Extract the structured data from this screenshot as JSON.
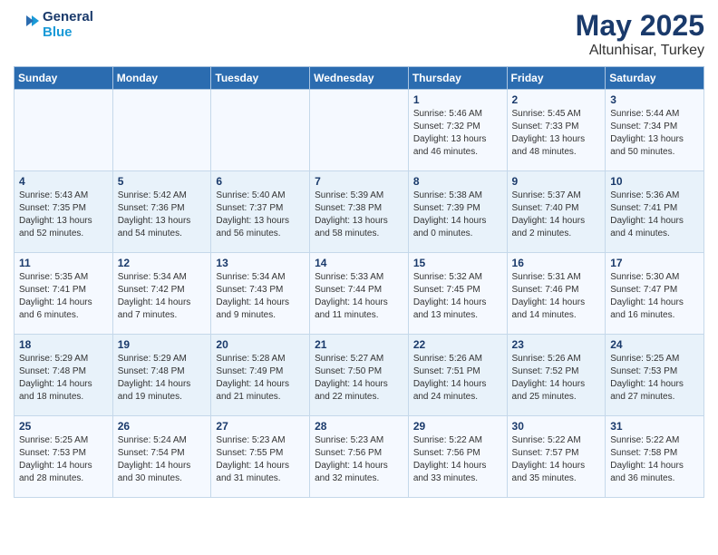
{
  "header": {
    "logo_line1": "General",
    "logo_line2": "Blue",
    "month": "May 2025",
    "location": "Altunhisar, Turkey"
  },
  "days_of_week": [
    "Sunday",
    "Monday",
    "Tuesday",
    "Wednesday",
    "Thursday",
    "Friday",
    "Saturday"
  ],
  "weeks": [
    [
      {
        "day": "",
        "info": ""
      },
      {
        "day": "",
        "info": ""
      },
      {
        "day": "",
        "info": ""
      },
      {
        "day": "",
        "info": ""
      },
      {
        "day": "1",
        "info": "Sunrise: 5:46 AM\nSunset: 7:32 PM\nDaylight: 13 hours\nand 46 minutes."
      },
      {
        "day": "2",
        "info": "Sunrise: 5:45 AM\nSunset: 7:33 PM\nDaylight: 13 hours\nand 48 minutes."
      },
      {
        "day": "3",
        "info": "Sunrise: 5:44 AM\nSunset: 7:34 PM\nDaylight: 13 hours\nand 50 minutes."
      }
    ],
    [
      {
        "day": "4",
        "info": "Sunrise: 5:43 AM\nSunset: 7:35 PM\nDaylight: 13 hours\nand 52 minutes."
      },
      {
        "day": "5",
        "info": "Sunrise: 5:42 AM\nSunset: 7:36 PM\nDaylight: 13 hours\nand 54 minutes."
      },
      {
        "day": "6",
        "info": "Sunrise: 5:40 AM\nSunset: 7:37 PM\nDaylight: 13 hours\nand 56 minutes."
      },
      {
        "day": "7",
        "info": "Sunrise: 5:39 AM\nSunset: 7:38 PM\nDaylight: 13 hours\nand 58 minutes."
      },
      {
        "day": "8",
        "info": "Sunrise: 5:38 AM\nSunset: 7:39 PM\nDaylight: 14 hours\nand 0 minutes."
      },
      {
        "day": "9",
        "info": "Sunrise: 5:37 AM\nSunset: 7:40 PM\nDaylight: 14 hours\nand 2 minutes."
      },
      {
        "day": "10",
        "info": "Sunrise: 5:36 AM\nSunset: 7:41 PM\nDaylight: 14 hours\nand 4 minutes."
      }
    ],
    [
      {
        "day": "11",
        "info": "Sunrise: 5:35 AM\nSunset: 7:41 PM\nDaylight: 14 hours\nand 6 minutes."
      },
      {
        "day": "12",
        "info": "Sunrise: 5:34 AM\nSunset: 7:42 PM\nDaylight: 14 hours\nand 7 minutes."
      },
      {
        "day": "13",
        "info": "Sunrise: 5:34 AM\nSunset: 7:43 PM\nDaylight: 14 hours\nand 9 minutes."
      },
      {
        "day": "14",
        "info": "Sunrise: 5:33 AM\nSunset: 7:44 PM\nDaylight: 14 hours\nand 11 minutes."
      },
      {
        "day": "15",
        "info": "Sunrise: 5:32 AM\nSunset: 7:45 PM\nDaylight: 14 hours\nand 13 minutes."
      },
      {
        "day": "16",
        "info": "Sunrise: 5:31 AM\nSunset: 7:46 PM\nDaylight: 14 hours\nand 14 minutes."
      },
      {
        "day": "17",
        "info": "Sunrise: 5:30 AM\nSunset: 7:47 PM\nDaylight: 14 hours\nand 16 minutes."
      }
    ],
    [
      {
        "day": "18",
        "info": "Sunrise: 5:29 AM\nSunset: 7:48 PM\nDaylight: 14 hours\nand 18 minutes."
      },
      {
        "day": "19",
        "info": "Sunrise: 5:29 AM\nSunset: 7:48 PM\nDaylight: 14 hours\nand 19 minutes."
      },
      {
        "day": "20",
        "info": "Sunrise: 5:28 AM\nSunset: 7:49 PM\nDaylight: 14 hours\nand 21 minutes."
      },
      {
        "day": "21",
        "info": "Sunrise: 5:27 AM\nSunset: 7:50 PM\nDaylight: 14 hours\nand 22 minutes."
      },
      {
        "day": "22",
        "info": "Sunrise: 5:26 AM\nSunset: 7:51 PM\nDaylight: 14 hours\nand 24 minutes."
      },
      {
        "day": "23",
        "info": "Sunrise: 5:26 AM\nSunset: 7:52 PM\nDaylight: 14 hours\nand 25 minutes."
      },
      {
        "day": "24",
        "info": "Sunrise: 5:25 AM\nSunset: 7:53 PM\nDaylight: 14 hours\nand 27 minutes."
      }
    ],
    [
      {
        "day": "25",
        "info": "Sunrise: 5:25 AM\nSunset: 7:53 PM\nDaylight: 14 hours\nand 28 minutes."
      },
      {
        "day": "26",
        "info": "Sunrise: 5:24 AM\nSunset: 7:54 PM\nDaylight: 14 hours\nand 30 minutes."
      },
      {
        "day": "27",
        "info": "Sunrise: 5:23 AM\nSunset: 7:55 PM\nDaylight: 14 hours\nand 31 minutes."
      },
      {
        "day": "28",
        "info": "Sunrise: 5:23 AM\nSunset: 7:56 PM\nDaylight: 14 hours\nand 32 minutes."
      },
      {
        "day": "29",
        "info": "Sunrise: 5:22 AM\nSunset: 7:56 PM\nDaylight: 14 hours\nand 33 minutes."
      },
      {
        "day": "30",
        "info": "Sunrise: 5:22 AM\nSunset: 7:57 PM\nDaylight: 14 hours\nand 35 minutes."
      },
      {
        "day": "31",
        "info": "Sunrise: 5:22 AM\nSunset: 7:58 PM\nDaylight: 14 hours\nand 36 minutes."
      }
    ]
  ]
}
